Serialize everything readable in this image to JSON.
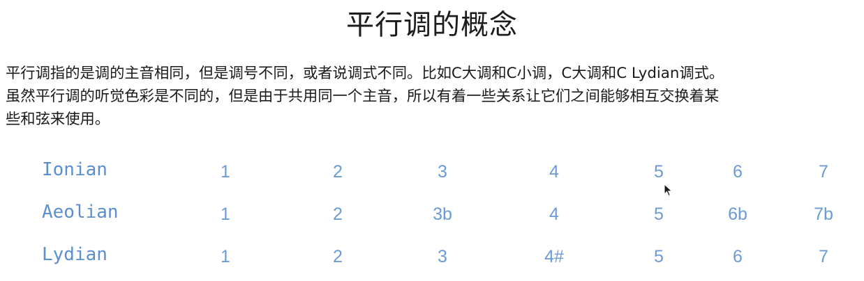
{
  "slide": {
    "title": "平行调的概念",
    "paragraph_lines": [
      "平行调指的是调的主音相同，但是调号不同，或者说调式不同。比如C大调和C小调，C大调和C Lydian调式。",
      "虽然平行调的听觉色彩是不同的，但是由于共用同一个主音，所以有着一些关系让它们之间能够相互交换着某",
      "些和弦来使用。"
    ]
  },
  "modes": [
    {
      "name": "Ionian",
      "degrees": [
        "1",
        "2",
        "3",
        "4",
        "5",
        "6",
        "7"
      ]
    },
    {
      "name": "Aeolian",
      "degrees": [
        "1",
        "2",
        "3b",
        "4",
        "5",
        "6b",
        "7b"
      ]
    },
    {
      "name": "Lydian",
      "degrees": [
        "1",
        "2",
        "3",
        "4#",
        "5",
        "6",
        "7"
      ]
    }
  ],
  "colors": {
    "title_text": "#1c1c1c",
    "body_text": "#1a1a1a",
    "mode_text": "#5b8fce",
    "degree_text": "#6a9bd6"
  },
  "icons": {
    "cursor": "mouse-pointer-icon"
  }
}
